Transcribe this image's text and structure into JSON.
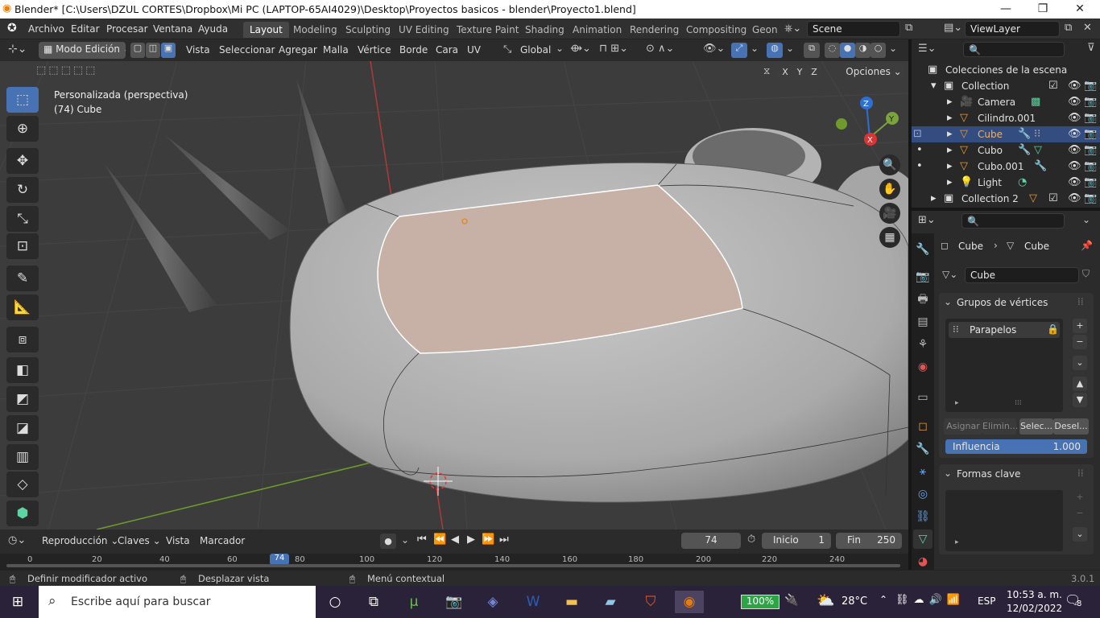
{
  "window": {
    "title": "Blender* [C:\\Users\\DZUL CORTES\\Dropbox\\Mi PC (LAPTOP-65AI4029)\\Desktop\\Proyectos basicos - blender\\Proyecto1.blend]",
    "minimize": "—",
    "maximize": "❐",
    "close": "✕"
  },
  "menu": [
    "Archivo",
    "Editar",
    "Procesar",
    "Ventana",
    "Ayuda"
  ],
  "workspaces": [
    "Layout",
    "Modeling",
    "Sculpting",
    "UV Editing",
    "Texture Paint",
    "Shading",
    "Animation",
    "Rendering",
    "Compositing",
    "Geon"
  ],
  "scene": "Scene",
  "view_layer": "ViewLayer",
  "header3d": {
    "mode": "Modo Edición",
    "menus": [
      "Vista",
      "Seleccionar",
      "Agregar",
      "Malla",
      "Vértice",
      "Borde",
      "Cara",
      "UV"
    ],
    "orientation": "Global",
    "options": "Opciones",
    "axes": [
      "X",
      "Y",
      "Z"
    ]
  },
  "viewport": {
    "line1": "Personalizada (perspectiva)",
    "line2": "(74) Cube",
    "gizmo": {
      "x": "X",
      "y": "Y",
      "z": "Z"
    },
    "colors": {
      "bg": "#3c3c3c",
      "mesh": "#b9b9b9",
      "face_sel": "#c7b1a6",
      "x_axis": "#c0392b",
      "y_axis": "#6e9b2a"
    }
  },
  "tools": [
    "cursor-select",
    "3d-cursor",
    "move",
    "rotate",
    "scale",
    "transform",
    "annotate",
    "measure",
    "add-cube",
    "extrude",
    "inset",
    "bevel",
    "loop-cut",
    "knife",
    "poly-build"
  ],
  "outliner": {
    "header": "Colecciones de la escena",
    "rows": [
      {
        "name": "Collection",
        "indent": 1
      },
      {
        "name": "Camera",
        "indent": 2
      },
      {
        "name": "Cilindro.001",
        "indent": 2
      },
      {
        "name": "Cube",
        "indent": 2,
        "selected": true
      },
      {
        "name": "Cubo",
        "indent": 2
      },
      {
        "name": "Cubo.001",
        "indent": 2
      },
      {
        "name": "Light",
        "indent": 2
      },
      {
        "name": "Collection 2",
        "indent": 1
      }
    ]
  },
  "properties": {
    "breadcrumb_obj": "Cube",
    "breadcrumb_data": "Cube",
    "mesh_name": "Cube",
    "vertex_groups_title": "Grupos de vértices",
    "vertex_group": "Parapelos",
    "assign": "Asignar",
    "remove": "Elimin...",
    "select": "Selec...",
    "deselect": "Desel...",
    "influence_label": "Influencia",
    "influence_value": "1.000",
    "shape_keys_title": "Formas clave"
  },
  "timeline": {
    "playback": "Reproducción",
    "keys": "Claves",
    "view": "Vista",
    "marker": "Marcador",
    "frame": "74",
    "start_label": "Inicio",
    "start": "1",
    "end_label": "Fin",
    "end": "250",
    "ticks": [
      "0",
      "20",
      "40",
      "60",
      "80",
      "100",
      "120",
      "140",
      "160",
      "180",
      "200",
      "220",
      "240"
    ],
    "current_tick": "74"
  },
  "status": {
    "left": "Definir modificador activo",
    "middle": "Desplazar vista",
    "right": "Menú contextual",
    "version": "3.0.1"
  },
  "taskbar": {
    "search_placeholder": "Escribe aquí para buscar",
    "battery": "100%",
    "temp": "28°C",
    "lang": "ESP",
    "time": "10:53 a. m.",
    "date": "12/02/2022",
    "notif": "8"
  }
}
